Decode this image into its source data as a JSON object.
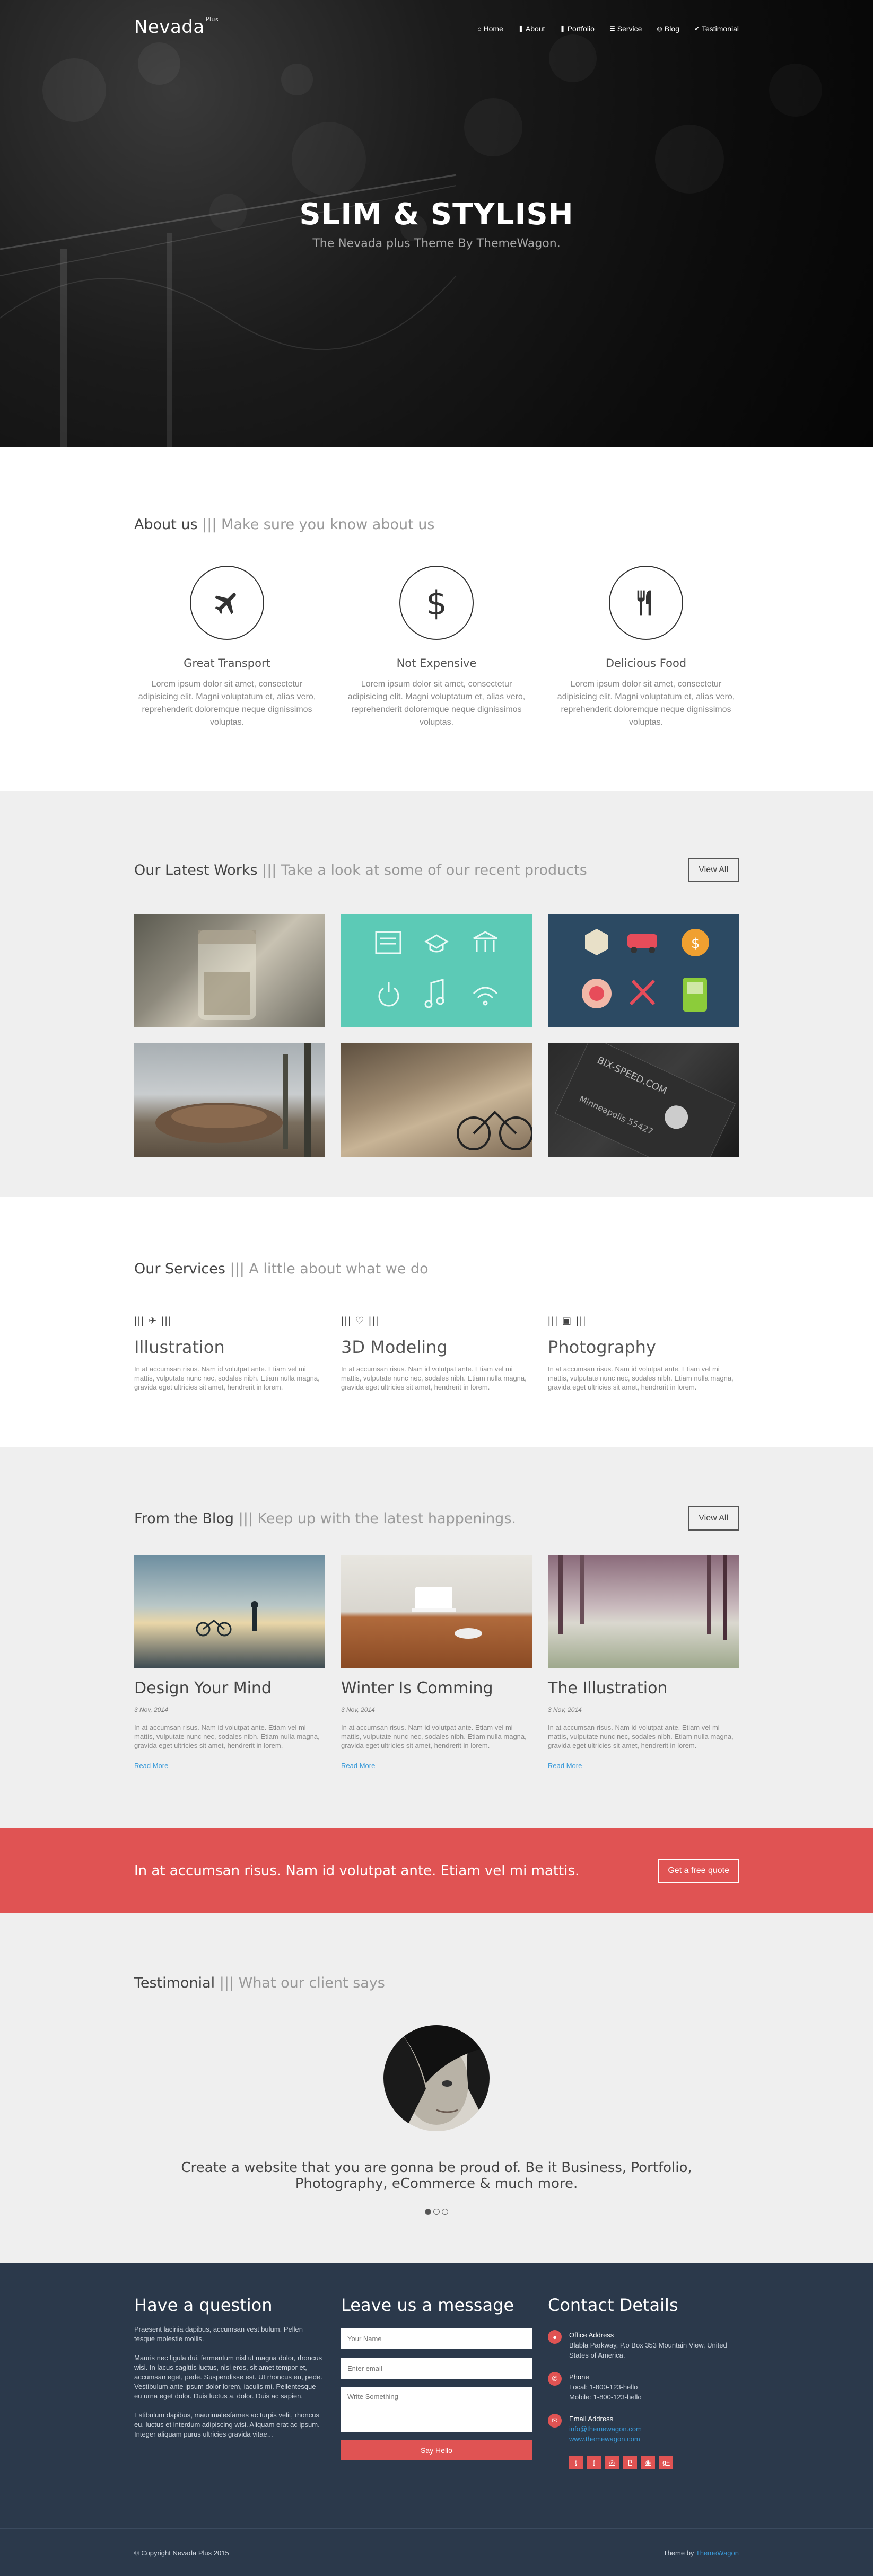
{
  "nav": {
    "logo": "Nevada",
    "logo_sup": "Plus",
    "items": [
      {
        "icon": "home-icon",
        "glyph": "⌂",
        "label": "Home"
      },
      {
        "icon": "bookmark-icon",
        "glyph": "❚",
        "label": "About"
      },
      {
        "icon": "bookmark-icon",
        "glyph": "❚",
        "label": "Portfolio"
      },
      {
        "icon": "list-icon",
        "glyph": "☰",
        "label": "Service"
      },
      {
        "icon": "globe-icon",
        "glyph": "◍",
        "label": "Blog"
      },
      {
        "icon": "thumbs-up-icon",
        "glyph": "✔",
        "label": "Testimonial"
      }
    ]
  },
  "hero": {
    "title": "SLIM & STYLISH",
    "subtitle": "The Nevada plus Theme By ThemeWagon."
  },
  "about": {
    "title": "About us",
    "subtitle": "||| Make sure you know about us",
    "features": [
      {
        "icon": "plane-icon",
        "title": "Great Transport",
        "text": "Lorem ipsum dolor sit amet, consectetur adipisicing elit. Magni voluptatum et, alias vero, reprehenderit doloremque neque dignissimos voluptas."
      },
      {
        "icon": "dollar-icon",
        "title": "Not Expensive",
        "text": "Lorem ipsum dolor sit amet, consectetur adipisicing elit. Magni voluptatum et, alias vero, reprehenderit doloremque neque dignissimos voluptas."
      },
      {
        "icon": "cutlery-icon",
        "title": "Delicious Food",
        "text": "Lorem ipsum dolor sit amet, consectetur adipisicing elit. Magni voluptatum et, alias vero, reprehenderit doloremque neque dignissimos voluptas."
      }
    ]
  },
  "works": {
    "title": "Our Latest Works",
    "subtitle": "||| Take a look at some of our recent products",
    "view_all": "View All"
  },
  "services": {
    "title": "Our Services",
    "subtitle": "||| A little about what we do",
    "items": [
      {
        "glyph": "||| ✈ |||",
        "title": "Illustration",
        "text": "In at accumsan risus. Nam id volutpat ante. Etiam vel mi mattis, vulputate nunc nec, sodales nibh. Etiam nulla magna, gravida eget ultricies sit amet, hendrerit in lorem."
      },
      {
        "glyph": "||| ♡ |||",
        "title": "3D Modeling",
        "text": "In at accumsan risus. Nam id volutpat ante. Etiam vel mi mattis, vulputate nunc nec, sodales nibh. Etiam nulla magna, gravida eget ultricies sit amet, hendrerit in lorem."
      },
      {
        "glyph": "||| ▣ |||",
        "title": "Photography",
        "text": "In at accumsan risus. Nam id volutpat ante. Etiam vel mi mattis, vulputate nunc nec, sodales nibh. Etiam nulla magna, gravida eget ultricies sit amet, hendrerit in lorem."
      }
    ]
  },
  "blog": {
    "title": "From the Blog",
    "subtitle": "||| Keep up with the latest happenings.",
    "view_all": "View All",
    "posts": [
      {
        "title": "Design Your Mind",
        "date": "3 Nov, 2014",
        "text": "In at accumsan risus. Nam id volutpat ante. Etiam vel mi mattis, vulputate nunc nec, sodales nibh. Etiam nulla magna, gravida eget ultricies sit amet, hendrerit in lorem.",
        "more": "Read More"
      },
      {
        "title": "Winter Is Comming",
        "date": "3 Nov, 2014",
        "text": "In at accumsan risus. Nam id volutpat ante. Etiam vel mi mattis, vulputate nunc nec, sodales nibh. Etiam nulla magna, gravida eget ultricies sit amet, hendrerit in lorem.",
        "more": "Read More"
      },
      {
        "title": "The Illustration",
        "date": "3 Nov, 2014",
        "text": "In at accumsan risus. Nam id volutpat ante. Etiam vel mi mattis, vulputate nunc nec, sodales nibh. Etiam nulla magna, gravida eget ultricies sit amet, hendrerit in lorem.",
        "more": "Read More"
      }
    ]
  },
  "cta": {
    "text": "In at accumsan risus. Nam id volutpat ante. Etiam vel mi mattis.",
    "button": "Get a free quote"
  },
  "testimonial": {
    "title": "Testimonial",
    "subtitle": "||| What our client says",
    "quote": "Create a website that you are gonna be proud of. Be it Business, Portfolio, Photography, eCommerce & much more."
  },
  "footer": {
    "question_title": "Have a question",
    "question_p1": "Praesent lacinia dapibus, accumsan vest bulum. Pellen tesque molestie mollis.",
    "question_p2": "Mauris nec ligula dui, fermentum nisl ut magna dolor, rhoncus wisi. In lacus sagittis luctus, nisi eros, sit amet tempor et, accumsan eget, pede. Suspendisse est. Ut rhoncus eu, pede. Vestibulum ante ipsum dolor lorem, iaculis mi. Pellentesque eu urna eget dolor. Duis luctus a, dolor. Duis ac sapien.",
    "question_p3": "Estibulum dapibus, maurimalesfames ac turpis velit, rhoncus eu, luctus et interdum adipiscing wisi. Aliquam erat ac ipsum. Integer aliquam purus ultricies gravida vitae...",
    "message_title": "Leave us a message",
    "name_placeholder": "Your Name",
    "email_placeholder": "Enter email",
    "message_placeholder": "Write Something",
    "submit": "Say Hello",
    "contact_title": "Contact Details",
    "office_head": "Office Address",
    "office_text": "Blabla Parkway, P.o Box 353 Mountain View, United States of America.",
    "phone_head": "Phone",
    "phone_local": "Local: 1-800-123-hello",
    "phone_mobile": "Mobile: 1-800-123-hello",
    "email_head": "Email Address",
    "email_1": "info@themewagon.com",
    "email_2": "www.themewagon.com",
    "socials": [
      {
        "icon": "twitter-icon",
        "glyph": "t"
      },
      {
        "icon": "facebook-icon",
        "glyph": "f"
      },
      {
        "icon": "instagram-icon",
        "glyph": "◎"
      },
      {
        "icon": "pinterest-icon",
        "glyph": "P"
      },
      {
        "icon": "dribbble-icon",
        "glyph": "◉"
      },
      {
        "icon": "google-plus-icon",
        "glyph": "g+"
      }
    ],
    "copyright": "© Copyright Nevada Plus 2015",
    "theme_by": "Theme by",
    "theme_link": "ThemeWagon"
  },
  "colors": {
    "accent": "#e05353",
    "footer_bg": "#2b394b",
    "link": "#3a9ad9"
  }
}
